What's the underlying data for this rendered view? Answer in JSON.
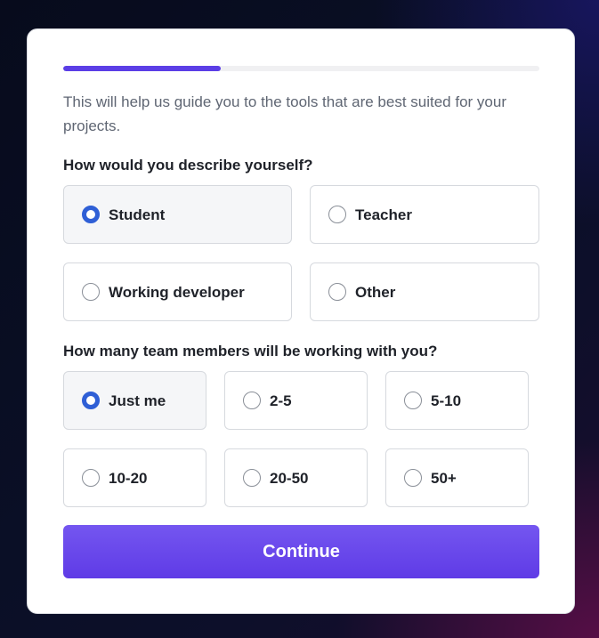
{
  "onboarding": {
    "progress_percent": 33,
    "intro_text": "This will help us guide you to the tools that are best suited for your projects.",
    "role_question": "How would you describe yourself?",
    "role_options": [
      {
        "label": "Student",
        "selected": true
      },
      {
        "label": "Teacher",
        "selected": false
      },
      {
        "label": "Working developer",
        "selected": false
      },
      {
        "label": "Other",
        "selected": false
      }
    ],
    "team_question": "How many team members will be working with you?",
    "team_options": [
      {
        "label": "Just me",
        "selected": true
      },
      {
        "label": "2-5",
        "selected": false
      },
      {
        "label": "5-10",
        "selected": false
      },
      {
        "label": "10-20",
        "selected": false
      },
      {
        "label": "20-50",
        "selected": false
      },
      {
        "label": "50+",
        "selected": false
      }
    ],
    "continue_label": "Continue"
  },
  "colors": {
    "accent": "#5b3ee6",
    "radio_selected": "#2f5fd6",
    "button_top": "#7456f0",
    "button_bottom": "#5f3be6"
  }
}
